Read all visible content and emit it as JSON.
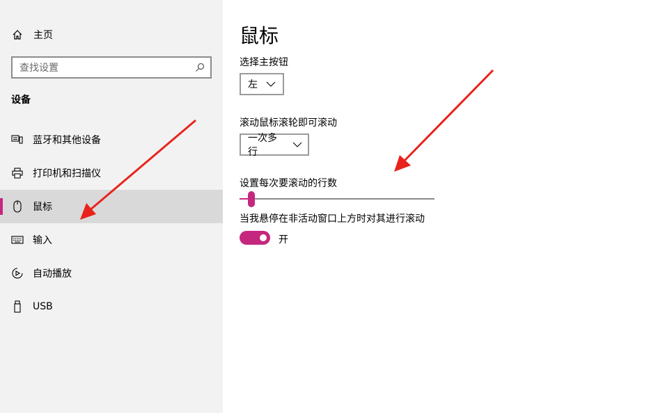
{
  "sidebar": {
    "home_label": "主页",
    "search_placeholder": "查找设置",
    "section_title": "设备",
    "items": [
      {
        "label": "蓝牙和其他设备",
        "icon": "bluetooth-devices-icon"
      },
      {
        "label": "打印机和扫描仪",
        "icon": "printer-icon"
      },
      {
        "label": "鼠标",
        "icon": "mouse-icon",
        "selected": true
      },
      {
        "label": "输入",
        "icon": "keyboard-icon"
      },
      {
        "label": "自动播放",
        "icon": "autoplay-icon"
      },
      {
        "label": "USB",
        "icon": "usb-icon"
      }
    ]
  },
  "main": {
    "title": "鼠标",
    "primary_button": {
      "label": "选择主按钮",
      "value": "左"
    },
    "scroll_wheel": {
      "label": "滚动鼠标滚轮即可滚动",
      "value": "一次多行"
    },
    "scroll_lines": {
      "label": "设置每次要滚动的行数",
      "value_fraction": 0.03
    },
    "inactive_scroll": {
      "label": "当我悬停在非活动窗口上方时对其进行滚动",
      "state_label": "开",
      "on": true
    }
  },
  "colors": {
    "accent": "#c5277f",
    "annotation_arrow": "#e8231c",
    "sidebar_bg": "#f2f2f2",
    "selected_bg": "#d9d9d9"
  }
}
